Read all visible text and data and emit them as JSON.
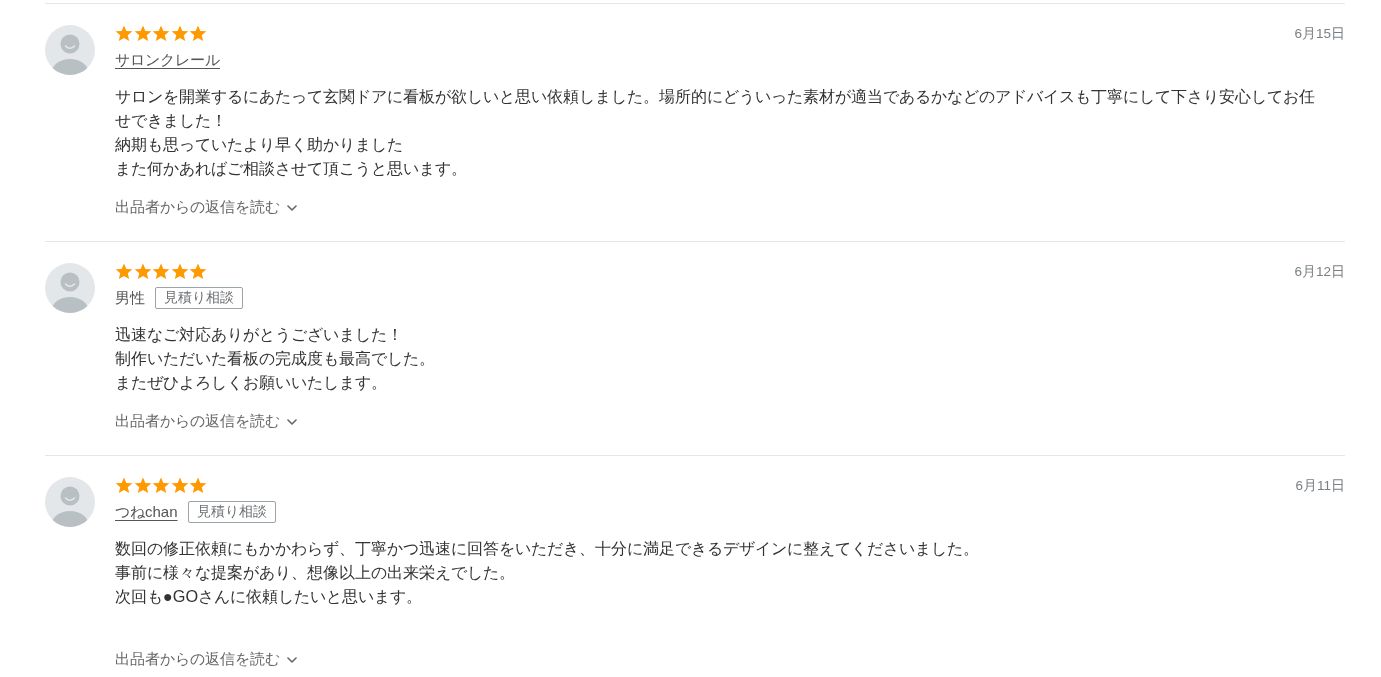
{
  "reviews": [
    {
      "stars": 5,
      "date": "6月15日",
      "author": {
        "name": "サロンクレール",
        "linked": true
      },
      "body_lines": [
        "サロンを開業するにあたって玄関ドアに看板が欲しいと思い依頼しました。場所的にどういった素材が適当であるかなどのアドバイスも丁寧にして下さり安心してお任せできました！",
        "納期も思っていたより早く助かりました",
        "また何かあればご相談させて頂こうと思います。"
      ],
      "reply_link": {
        "label": "出品者からの返信を読む",
        "expanded": false
      }
    },
    {
      "stars": 5,
      "date": "6月12日",
      "author": {
        "name": "男性",
        "linked": false
      },
      "tag": "見積り相談",
      "body_lines": [
        "迅速なご対応ありがとうございました！",
        "制作いただいた看板の完成度も最高でした。",
        "またぜひよろしくお願いいたします。"
      ],
      "reply_link": {
        "label": "出品者からの返信を読む",
        "expanded": false
      }
    },
    {
      "stars": 5,
      "date": "6月11日",
      "author": {
        "name": "つねchan",
        "linked": true
      },
      "tag": "見積り相談",
      "body_lines": [
        "数回の修正依頼にもかかわらず、丁寧かつ迅速に回答をいただき、十分に満足できるデザインに整えてくださいました。",
        "事前に様々な提案があり、想像以上の出来栄えでした。",
        "次回も●GOさんに依頼したいと思います。"
      ],
      "reply_link": {
        "label": "出品者からの返信を読む",
        "expanded": false
      }
    }
  ]
}
